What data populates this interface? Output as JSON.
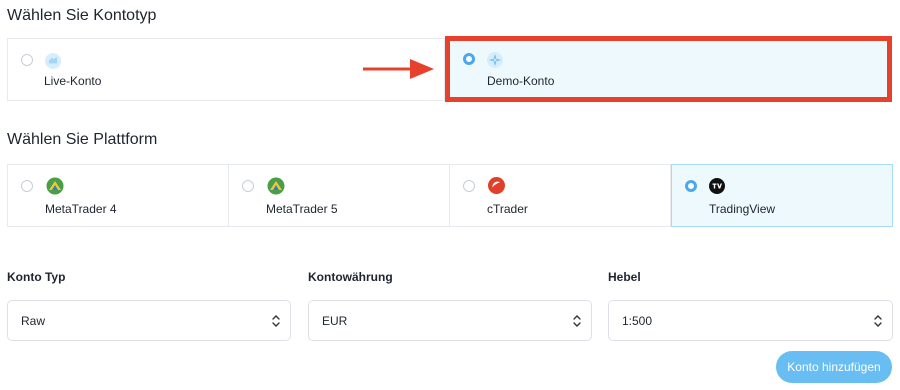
{
  "account_type": {
    "title": "Wählen Sie Kontotyp",
    "options": [
      {
        "label": "Live-Konto",
        "selected": false
      },
      {
        "label": "Demo-Konto",
        "selected": true
      }
    ]
  },
  "platform": {
    "title": "Wählen Sie Plattform",
    "options": [
      {
        "label": "MetaTrader 4",
        "selected": false
      },
      {
        "label": "MetaTrader 5",
        "selected": false
      },
      {
        "label": "cTrader",
        "selected": false
      },
      {
        "label": "TradingView",
        "selected": true
      }
    ]
  },
  "fields": {
    "konto_typ": {
      "label": "Konto Typ",
      "value": "Raw"
    },
    "waehrung": {
      "label": "Kontowährung",
      "value": "EUR"
    },
    "hebel": {
      "label": "Hebel",
      "value": "1:500"
    }
  },
  "submit_label": "Konto hinzufügen",
  "colors": {
    "accent": "#4aa8f0",
    "selected_bg": "#eef9fd",
    "highlight": "#e8412b",
    "button": "#68bdf3"
  },
  "icons": {
    "live": "live-account-icon",
    "demo": "demo-account-icon",
    "mt4": "metatrader-icon",
    "mt5": "metatrader-icon",
    "ctrader": "ctrader-icon",
    "tradingview": "tradingview-icon",
    "arrow": "red-arrow-icon"
  }
}
